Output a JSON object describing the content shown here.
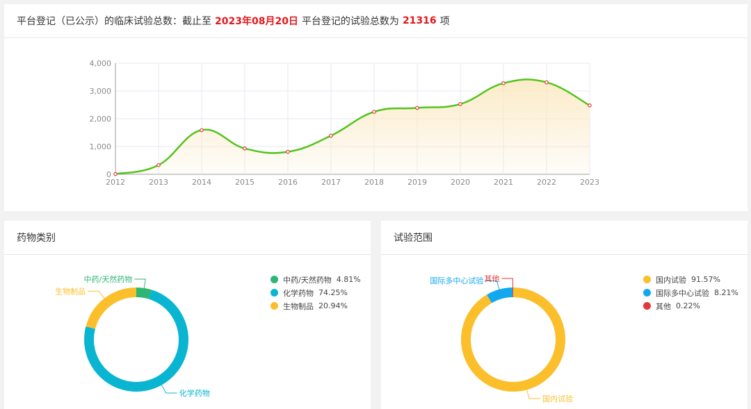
{
  "header": {
    "prefix": "平台登记（已公示）的临床试验总数：截止至",
    "date": "2023年08月20日",
    "middle": "平台登记的试验总数为",
    "total": "21316",
    "suffix": "项"
  },
  "colors": {
    "line": "#52c41a",
    "point": "#e4393c",
    "area_top": "#fbe9c2",
    "highlight": "#e4161b"
  },
  "chart_data": [
    {
      "type": "area",
      "x": [
        "2012",
        "2013",
        "2014",
        "2015",
        "2016",
        "2017",
        "2018",
        "2019",
        "2020",
        "2021",
        "2022",
        "2023"
      ],
      "values": [
        10,
        330,
        1590,
        930,
        810,
        1390,
        2250,
        2390,
        2530,
        3280,
        3310,
        2480
      ],
      "yticks": [
        "0",
        "1,000",
        "2,000",
        "3,000",
        "4,000"
      ],
      "ylim": [
        0,
        4000
      ],
      "grid": true,
      "smooth": true
    },
    {
      "type": "pie",
      "title": "药物类别",
      "labels": [
        "中药/天然药物",
        "化学药物",
        "生物制品"
      ],
      "values": [
        4.81,
        74.25,
        20.94
      ],
      "pct_labels": [
        "4.81%",
        "74.25%",
        "20.94%"
      ],
      "colors": [
        "#2fb675",
        "#0ab5d1",
        "#fbbf2c"
      ],
      "donut": true
    },
    {
      "type": "pie",
      "title": "试验范围",
      "labels": [
        "国内试验",
        "国际多中心试验",
        "其他"
      ],
      "values": [
        91.57,
        8.21,
        0.22
      ],
      "pct_labels": [
        "91.57%",
        "8.21%",
        "0.22%"
      ],
      "colors": [
        "#fbbf2c",
        "#11a8ef",
        "#e23a3a"
      ],
      "donut": true
    }
  ]
}
